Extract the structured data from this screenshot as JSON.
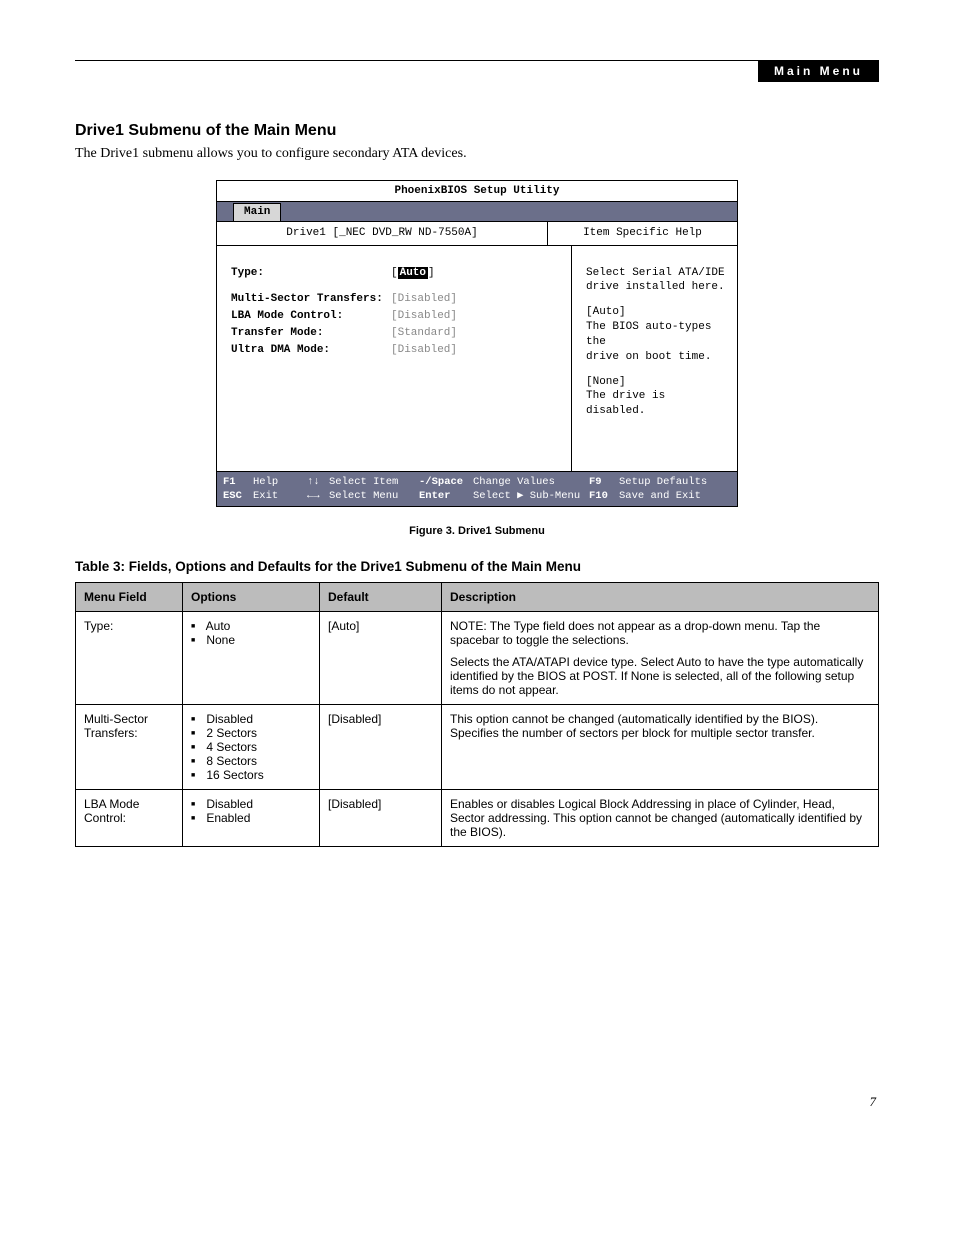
{
  "header": {
    "label": "Main Menu"
  },
  "section": {
    "title": "Drive1 Submenu of the Main Menu",
    "body": "The Drive1 submenu allows you to configure secondary ATA devices."
  },
  "bios": {
    "utility_title": "PhoenixBIOS Setup Utility",
    "tab": "Main",
    "panel_title": "Drive1 [_NEC DVD_RW ND-7550A]",
    "help_title": "Item Specific Help",
    "fields": {
      "type_label": "Type:",
      "type_value": "Auto",
      "multi_label": "Multi-Sector Transfers:",
      "multi_value": "[Disabled]",
      "lba_label": "LBA Mode Control:",
      "lba_value": "[Disabled]",
      "xfer_label": "Transfer Mode:",
      "xfer_value": "[Standard]",
      "udma_label": "Ultra DMA Mode:",
      "udma_value": "[Disabled]"
    },
    "help_text": {
      "l1": "Select Serial ATA/IDE",
      "l2": "drive installed here.",
      "l3": "[Auto]",
      "l4": "The BIOS auto-types the",
      "l5": "drive on boot time.",
      "l6": "[None]",
      "l7": "The drive is disabled."
    },
    "footer": {
      "r1a": "F1",
      "r1b": "Help",
      "r1c": "↑↓",
      "r1d": "Select Item",
      "r1e": "-/Space",
      "r1f": "Change Values",
      "r1g": "F9",
      "r1h": "Setup Defaults",
      "r2a": "ESC",
      "r2b": "Exit",
      "r2c": "←→",
      "r2d": "Select Menu",
      "r2e": "Enter",
      "r2f": "Select ▶ Sub-Menu",
      "r2g": "F10",
      "r2h": "Save and Exit"
    }
  },
  "figure_caption": "Figure 3.  Drive1 Submenu",
  "table": {
    "title": "Table 3: Fields, Options and Defaults for the Drive1 Submenu of the Main Menu",
    "headers": {
      "c1": "Menu Field",
      "c2": "Options",
      "c3": "Default",
      "c4": "Description"
    },
    "rows": [
      {
        "field": "Type:",
        "options": [
          "Auto",
          "None"
        ],
        "default": "[Auto]",
        "desc": [
          "NOTE: The Type field does not appear as a drop-down menu. Tap the spacebar to toggle the selections.",
          "Selects the ATA/ATAPI device type. Select Auto to have the type automatically identified by the BIOS at POST. If None is selected, all of the following setup items do not appear."
        ]
      },
      {
        "field": "Multi-Sector Transfers:",
        "options": [
          "Disabled",
          "2 Sectors",
          "4 Sectors",
          "8 Sectors",
          "16 Sectors"
        ],
        "default": "[Disabled]",
        "desc": [
          "This option cannot be changed (automatically identified by the BIOS). Specifies the number of sectors per block for multiple sector transfer."
        ]
      },
      {
        "field": "LBA Mode Control:",
        "options": [
          "Disabled",
          "Enabled"
        ],
        "default": "[Disabled]",
        "desc": [
          "Enables or disables Logical Block Addressing in place of Cylinder, Head, Sector addressing. This option cannot be changed (automatically identified by the BIOS)."
        ]
      }
    ]
  },
  "page_number": "7"
}
